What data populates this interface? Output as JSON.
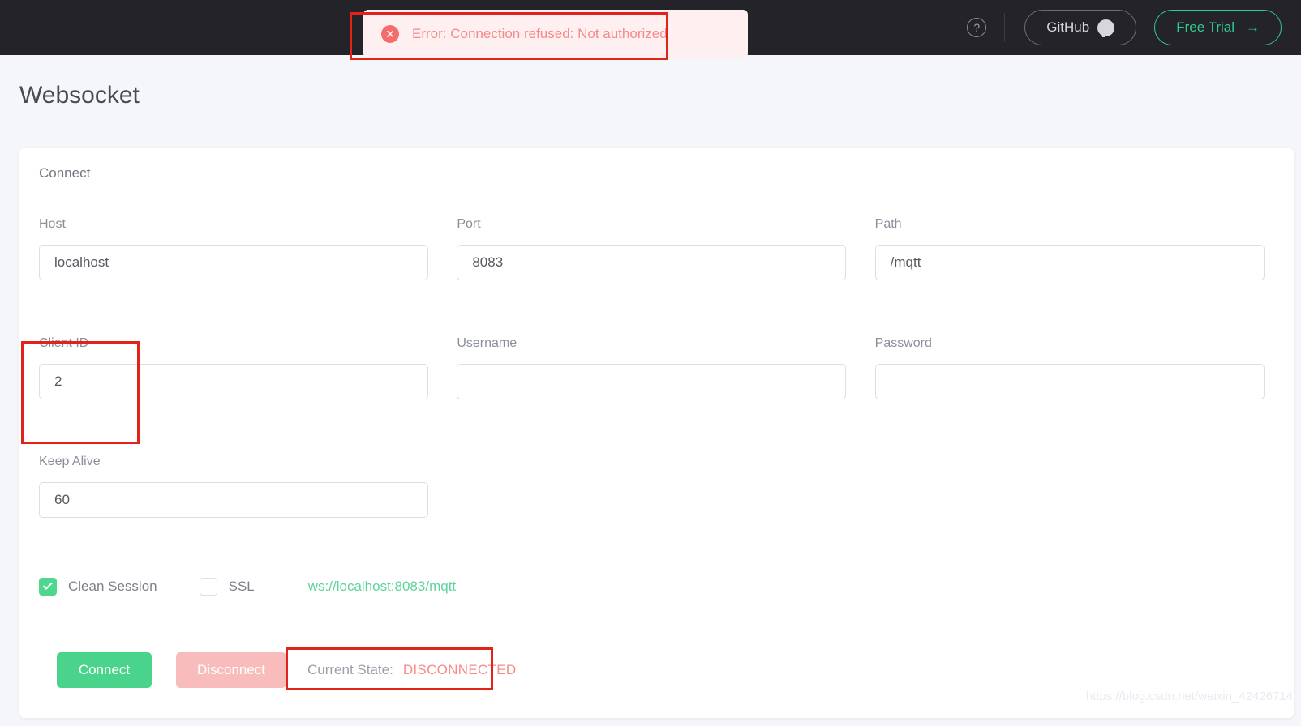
{
  "topnav": {
    "help_icon": "question-mark-circle-icon",
    "github_label": "GitHub",
    "github_icon": "github-mark-icon",
    "trial_label": "Free Trial",
    "trial_arrow": "→",
    "background": "#242329"
  },
  "toast": {
    "icon": "error-circle-icon",
    "icon_glyph": "✕",
    "message": "Error: Connection refused: Not authorized",
    "text_color": "#f78989",
    "background": "#fef0f0"
  },
  "annotations": {
    "color": "#e2231a",
    "boxes": [
      "toast-error-highlight",
      "client-id-highlight",
      "current-state-highlight"
    ]
  },
  "page": {
    "title": "Websocket",
    "background": "#f4f6fa"
  },
  "card": {
    "title": "Connect",
    "fields": {
      "host": {
        "label": "Host",
        "value": "localhost",
        "placeholder": ""
      },
      "port": {
        "label": "Port",
        "value": "8083",
        "placeholder": ""
      },
      "path": {
        "label": "Path",
        "value": "/mqtt",
        "placeholder": ""
      },
      "client_id": {
        "label": "Client ID",
        "value": "2",
        "placeholder": ""
      },
      "username": {
        "label": "Username",
        "value": "",
        "placeholder": ""
      },
      "password": {
        "label": "Password",
        "value": "",
        "placeholder": ""
      },
      "keep_alive": {
        "label": "Keep Alive",
        "value": "60",
        "placeholder": ""
      }
    },
    "options": {
      "clean_session": {
        "label": "Clean Session",
        "checked": true,
        "color": "#4ed88f"
      },
      "ssl": {
        "label": "SSL",
        "checked": false
      },
      "ws_url": "ws://localhost:8083/mqtt",
      "ws_url_color": "#5fd39c"
    },
    "actions": {
      "connect_label": "Connect",
      "connect_color": "#49d38b",
      "disconnect_label": "Disconnect",
      "disconnect_color": "#f9bcbc",
      "state_label": "Current State:",
      "state_value": "DISCONNECTED",
      "state_color": "#f98a8a"
    }
  },
  "watermark": {
    "text": "https://blog.csdn.net/weixin_42426714"
  }
}
